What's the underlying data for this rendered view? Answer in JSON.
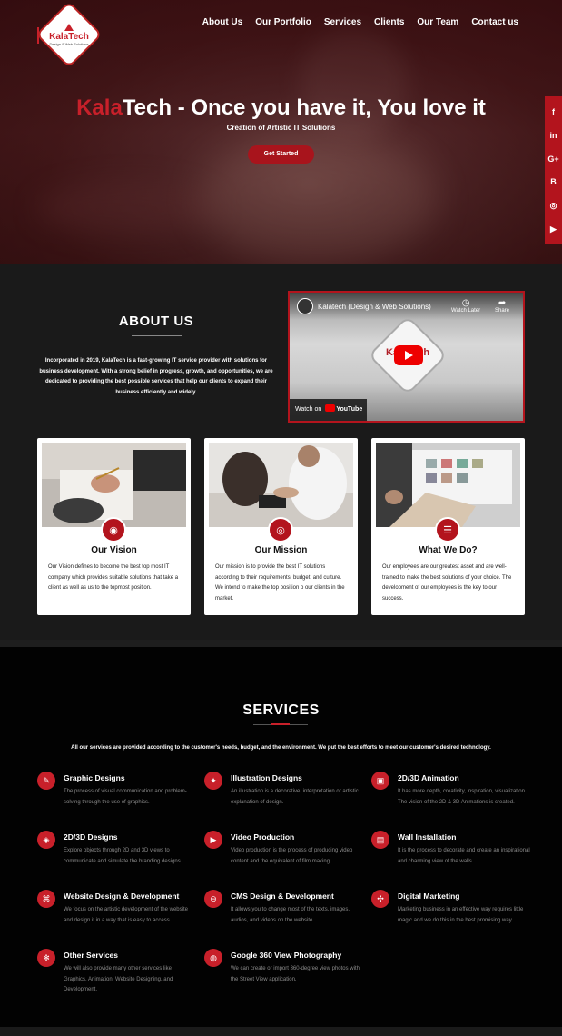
{
  "brand": {
    "name": "KalaTech",
    "tagline": "Design & Web Solutions"
  },
  "nav": [
    "About Us",
    "Our Portfolio",
    "Services",
    "Clients",
    "Our Team",
    "Contact us"
  ],
  "hero": {
    "title_highlight": "Kala",
    "title_rest": "Tech - Once you have it, You love it",
    "subtitle": "Creation of Artistic IT Solutions",
    "cta": "Get Started"
  },
  "social": [
    "f",
    "in",
    "G+",
    "B",
    "◎",
    "▶"
  ],
  "about": {
    "title": "ABOUT US",
    "text": "Incorporated in 2019, KalaTech is a fast-growing IT service provider with solutions for business development. With a strong belief in progress, growth, and opportunities, we are dedicated to providing the best possible services that help our clients to expand their business efficiently and widely."
  },
  "video": {
    "title": "Kalatech (Design & Web Solutions)",
    "watch_later": "Watch Later",
    "share": "Share",
    "watch_on": "Watch on",
    "youtube": "YouTube",
    "brand": "KalaTech"
  },
  "cards": [
    {
      "title": "Our Vision",
      "icon": "eye-icon",
      "text": "Our Vision defines to become the best top most IT company which provides suitable solutions that take a client as well as us to the topmost position."
    },
    {
      "title": "Our Mission",
      "icon": "target-icon",
      "text": "Our mission is to provide the best IT solutions according to their requirements, budget, and culture. We intend to make the top position o our clients in the market."
    },
    {
      "title": "What We Do?",
      "icon": "list-icon",
      "text": "Our employees are our greatest asset and are well-trained to make the best solutions of your choice. The development of our employees is the key to our success."
    }
  ],
  "services": {
    "title": "SERVICES",
    "intro": "All our services are provided according to the customer's needs, budget, and the environment. We put the best efforts to meet our customer's desired technology.",
    "items": [
      {
        "title": "Graphic Designs",
        "text": "The process of visual communication and problem-solving through the use of graphics."
      },
      {
        "title": "Illustration Designs",
        "text": "An illustration is a decorative, interpretation or artistic explanation of design."
      },
      {
        "title": "2D/3D Animation",
        "text": "It has more depth, creativity, inspiration, visualization. The vision of the 2D & 3D Animations is created."
      },
      {
        "title": "2D/3D Designs",
        "text": "Explore objects through 2D and 3D views to communicate and simulate the branding designs."
      },
      {
        "title": "Video Production",
        "text": "Video production is the process of producing video content and the equivalent of film making."
      },
      {
        "title": "Wall Installation",
        "text": "It is the process to decorate and create an inspirational and charming view of the walls."
      },
      {
        "title": "Website Design & Development",
        "text": "We focus on the artistic development of the website and design it in a way that is easy to access."
      },
      {
        "title": "CMS Design & Development",
        "text": "It allows you to change most of the texts, images, audios, and videos on the website."
      },
      {
        "title": "Digital Marketing",
        "text": "Marketing business in an effective way requires little magic and we do this in the best promising way."
      },
      {
        "title": "Other Services",
        "text": "We will also provide many other services like Graphics, Animation, Website Designing, and Development."
      },
      {
        "title": "Google 360 View Photography",
        "text": "We can create or import 360-degree view photos with the Street View application."
      }
    ]
  },
  "colors": {
    "accent": "#c8202a",
    "dark": "#020202",
    "panel": "#1a1a1a"
  }
}
